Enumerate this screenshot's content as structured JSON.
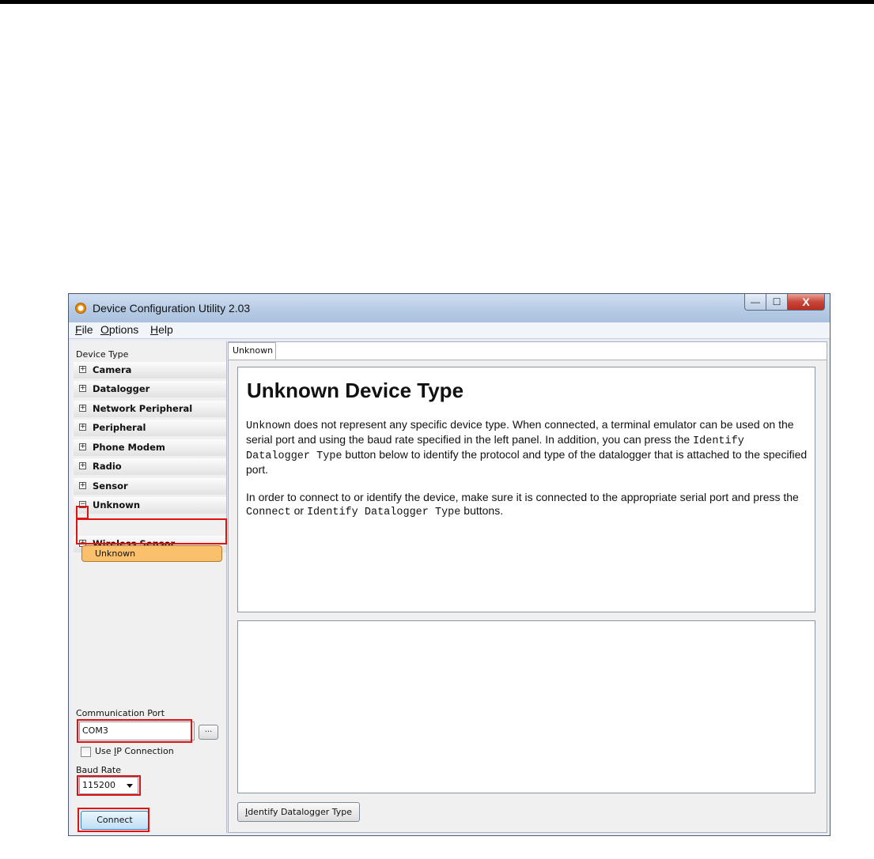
{
  "window": {
    "title": "Device Configuration Utility 2.03",
    "minimize_glyph": "—",
    "maximize_glyph": "☐",
    "close_glyph": "X"
  },
  "menu": [
    {
      "label_u": "F",
      "label_rest": "ile"
    },
    {
      "label_u": "O",
      "label_rest": "ptions"
    },
    {
      "label_u": "H",
      "label_rest": "elp"
    }
  ],
  "left_panel": {
    "device_type_label": "Device Type",
    "tree": [
      {
        "label": "Camera",
        "expander": "+"
      },
      {
        "label": "Datalogger",
        "expander": "+"
      },
      {
        "label": "Network Peripheral",
        "expander": "+"
      },
      {
        "label": "Peripheral",
        "expander": "+"
      },
      {
        "label": "Phone Modem",
        "expander": "+"
      },
      {
        "label": "Radio",
        "expander": "+"
      },
      {
        "label": "Sensor",
        "expander": "+"
      },
      {
        "label": "Unknown",
        "expander": "−"
      },
      {
        "label": "Wireless Sensor",
        "expander": "+"
      }
    ],
    "selected_child": "Unknown",
    "comm_port_label": "Communication Port",
    "comm_port_value": "COM3",
    "browse_label": "...",
    "use_ip_pre": "Use ",
    "use_ip_u": "I",
    "use_ip_post": "P Connection",
    "use_ip_checked": false,
    "baud_label": "Baud Rate",
    "baud_value": "115200",
    "connect_label": "Connect"
  },
  "main": {
    "tab_label": "Unknown",
    "heading": "Unknown Device Type",
    "p1": {
      "t1": "Unknown",
      "t2": " does not represent any specific device type. When connected, a terminal emulator can be used on the serial port and using the baud rate specified in the left panel. In addition, you can press the ",
      "t3": "Identify Datalogger Type",
      "t4": " button below to identify the protocol and type of the datalogger that is attached to the specified port."
    },
    "p2": {
      "t1": "In order to connect to or identify the device, make sure it is connected to the appropriate serial port and press the ",
      "t2": "Connect",
      "t3": " or ",
      "t4": "Identify Datalogger Type",
      "t5": " buttons."
    },
    "identify_u": "I",
    "identify_rest": "dentify Datalogger Type"
  },
  "colors": {
    "highlight_box": "#e31010",
    "selected_item": "#fbc06b"
  }
}
